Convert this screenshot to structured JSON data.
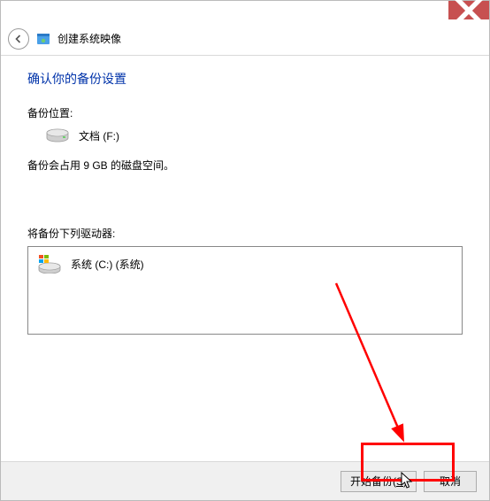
{
  "titlebar": {
    "close_tooltip": "关闭"
  },
  "header": {
    "title": "创建系统映像"
  },
  "content": {
    "heading": "确认你的备份设置",
    "location_label": "备份位置:",
    "location_drive": "文档 (F:)",
    "size_note": "备份会占用 9 GB 的磁盘空间。",
    "selection_label": "将备份下列驱动器:",
    "drives": [
      {
        "label": "系统 (C:) (系统)"
      }
    ]
  },
  "footer": {
    "start_label_prefix": "开始备份(",
    "start_label_key": "S",
    "start_label_suffix": ")",
    "cancel_label": "取消"
  }
}
